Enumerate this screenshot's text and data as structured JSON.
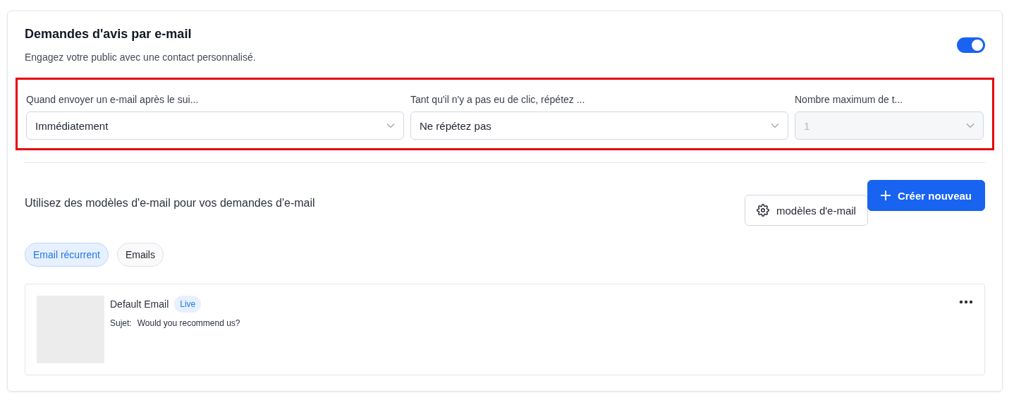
{
  "header": {
    "title": "Demandes d'avis par e-mail",
    "subtitle": "Engagez votre public avec une contact personnalisé.",
    "enabled": true
  },
  "settings": {
    "highlighted": true,
    "fields": [
      {
        "label": "Quand envoyer un e-mail après le sui...",
        "value": "Immédiatement",
        "disabled": false
      },
      {
        "label": "Tant qu'il n'y a pas eu de clic, répétez ...",
        "value": "Ne répétez pas",
        "disabled": false
      },
      {
        "label": "Nombre maximum de t...",
        "value": "1",
        "disabled": true
      }
    ]
  },
  "templates": {
    "heading": "Utilisez des modèles d'e-mail pour vos demandes d'e-mail",
    "buttons": [
      {
        "kind": "settings",
        "label": "modèles d'e-mail"
      },
      {
        "kind": "create",
        "label": "Créer nouveau"
      }
    ],
    "tabs": [
      {
        "label": "Email récurrent",
        "selected": true
      },
      {
        "label": "Emails",
        "selected": false
      }
    ],
    "items": [
      {
        "name": "Default Email",
        "badge": "Live",
        "subject_label": "Sujet:",
        "subject": "Would you recommend us?"
      }
    ]
  }
}
